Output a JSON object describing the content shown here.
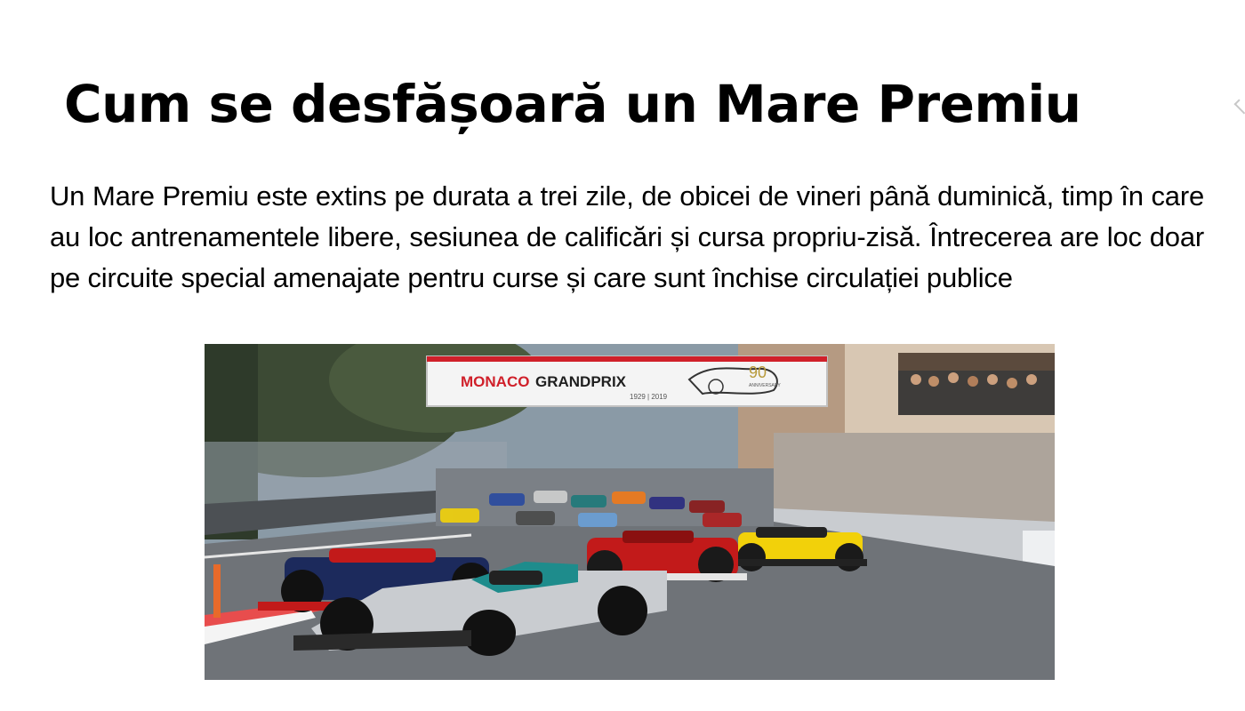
{
  "slide": {
    "title": "Cum se desfășoară un Mare Premiu",
    "body": "Un Mare Premiu este extins pe durata a trei zile, de  obicei  de  vineri  până duminică, timp în care au loc antrenamentele libere, sesiunea de calificări și  cursa  propriu-zisă. Întrecerea are loc doar pe circuite special amenajate pentru curse și care sunt  închise circulației publice"
  },
  "photo": {
    "banner_left": "MONACO",
    "banner_right": "GRANDPRIX",
    "banner_years": "1929 | 2019",
    "banner_anniversary": "90",
    "banner_anniversary_sub": "ANNIVERSARY",
    "colors": {
      "sky": "#8a9aa6",
      "tarmac": "#6f7378",
      "banner_red": "#d0202a",
      "banner_bg": "#f4f4f4",
      "mercedes": "#c9ccd0",
      "ferrari": "#c21a1a",
      "redbull": "#1c2a5c",
      "renault": "#f2d10a",
      "trees": "#3c4a34"
    }
  }
}
